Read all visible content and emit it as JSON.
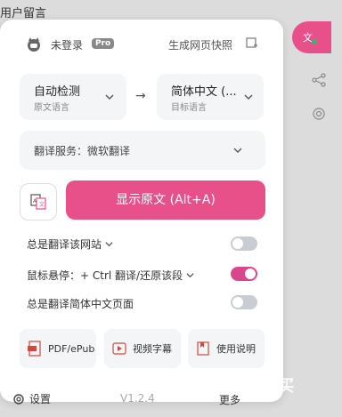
{
  "background": {
    "label": "用户留言"
  },
  "header": {
    "user_status": "未登录",
    "pro_badge": "Pro",
    "snapshot_link": "生成网页快照"
  },
  "languages": {
    "source": {
      "main": "自动检测",
      "sub": "原文语言"
    },
    "target": {
      "main": "简体中文 (...",
      "sub": "目标语言"
    },
    "arrow": "→"
  },
  "service": {
    "label": "翻译服务：微软翻译"
  },
  "primary_button": {
    "label": "显示原文 (Alt+A)"
  },
  "options": [
    {
      "label": "总是翻译该网站",
      "has_dropdown": true,
      "enabled": false
    },
    {
      "label": "鼠标悬停：+ Ctrl 翻译/还原该段",
      "has_dropdown": true,
      "enabled": true
    },
    {
      "label": "总是翻译简体中文页面",
      "has_dropdown": false,
      "enabled": false
    }
  ],
  "tools": [
    {
      "label": "PDF/ePub",
      "icon": "pdf-icon"
    },
    {
      "label": "视频字幕",
      "icon": "video-icon"
    },
    {
      "label": "使用说明",
      "icon": "book-icon"
    }
  ],
  "footer": {
    "settings_label": "设置",
    "version": "V1.2.4",
    "more_label": "更多"
  },
  "watermark": "值 得买",
  "colors": {
    "accent": "#e8508a",
    "panel_bg": "#ffffff",
    "field_bg": "#f4f5f7"
  }
}
